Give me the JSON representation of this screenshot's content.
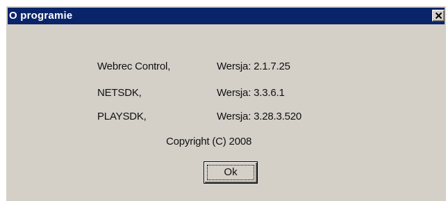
{
  "window": {
    "title": "O programie",
    "close_symbol": "✕"
  },
  "components": [
    {
      "name": "Webrec Control,",
      "version": "Wersja: 2.1.7.25"
    },
    {
      "name": "NETSDK,",
      "version": "Wersja: 3.3.6.1"
    },
    {
      "name": "PLAYSDK,",
      "version": "Wersja: 3.28.3.520"
    }
  ],
  "copyright": "Copyright (C) 2008",
  "buttons": {
    "ok_label": "Ok"
  },
  "colors": {
    "titlebar": "#0a246a",
    "dialog_face": "#d4d0c8"
  },
  "icons": {
    "close": "close-icon"
  }
}
